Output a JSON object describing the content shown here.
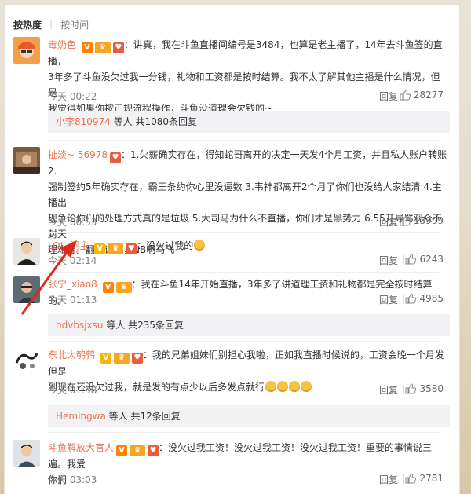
{
  "sort": {
    "active": "按热度",
    "other": "按时间"
  },
  "comments": [
    {
      "user": "毒奶色",
      "text1": "：讲真，我在斗鱼直播间编号是3484，也算是老主播了，14年去斗鱼签的直播，",
      "text2": "3年多了斗鱼没欠过我一分钱，礼物和工资都是按时结算。我不太了解其他主播是什么情况，但是",
      "text3": "我觉得如果你按正规流程操作，斗鱼没道理会欠钱的~",
      "time": "今天 00:22",
      "reply": "回复",
      "likes": "28277",
      "sub_user": "小李810974",
      "sub_text": "等人 共1080条回复"
    },
    {
      "user": "扯淡~ 56978",
      "text1": "：1.欠薪确实存在，得知蛇哥离开的决定一天发4个月工资，并且私人账户转账 2.",
      "text2": "强制签约5年确实存在，霸王条约你心里没逼数 3.韦神都离开2个月了你们也没给人家结清 4.主播出",
      "text3": "现争论你们的处理方式真的是垃圾 5.大司马为什么不直播，你们才是黑势力 6.55开导骂观众不封天",
      "text4": "理难容。翻我评论，NB啊马飞",
      "time": "今天 00:53",
      "reply": "回复",
      "likes": "13999"
    },
    {
      "user": "LOL_洞主",
      "text1": "：没欠过我的",
      "time": "今天 02:14",
      "reply": "回复",
      "likes": "6243"
    },
    {
      "user": "张宁_xiao8",
      "text1": "：我在斗鱼14年开始直播，3年多了讲道理工资和礼物都是完全按时结算的。",
      "time": "今天 01:13",
      "reply": "回复",
      "likes": "4985",
      "sub_user": "hdvbsjxsu",
      "sub_text": "等人 共235条回复"
    },
    {
      "user": "东北大鹌鹑",
      "text1": "：我的兄弟姐妹们别担心我啦，正如我直播时候说的，工资会晚一个月发但是",
      "text2": "到现在还没欠过我，就是发的有点少以后多发点就行",
      "time": "今天 01:58",
      "reply": "回复",
      "likes": "3580",
      "sub_user": "Hemingwa",
      "sub_text": "等人 共12条回复"
    },
    {
      "user": "斗鱼解放大官人",
      "text1": "：没欠过我工资！没欠过我工资！没欠过我工资！重要的事情说三遍。我爱",
      "text2": "你们",
      "time": "今天 03:03",
      "reply": "回复",
      "likes": "2781"
    }
  ]
}
